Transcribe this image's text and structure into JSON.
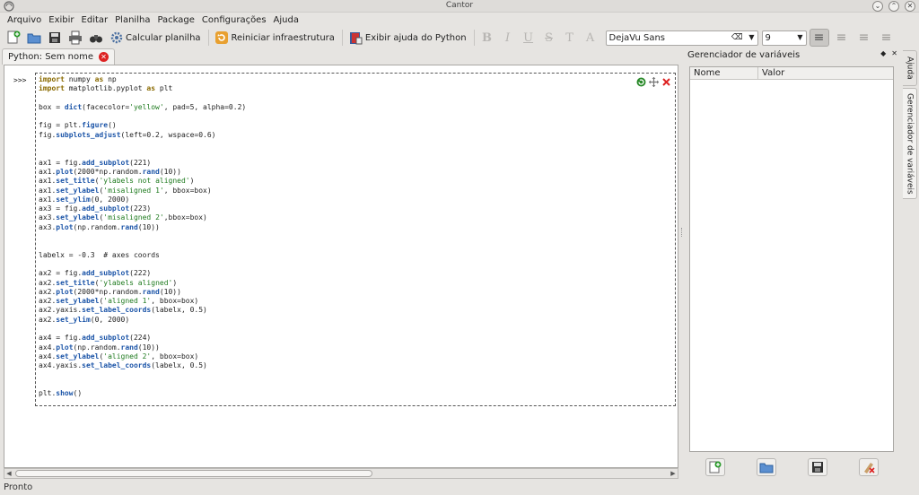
{
  "window": {
    "title": "Cantor"
  },
  "menu": [
    "Arquivo",
    "Exibir",
    "Editar",
    "Planilha",
    "Package",
    "Configurações",
    "Ajuda"
  ],
  "toolbar": {
    "calc_label": "Calcular planilha",
    "restart_label": "Reiniciar infraestrutura",
    "help_label": "Exibir ajuda do Python",
    "font": "DejaVu Sans",
    "size": "9"
  },
  "tab": {
    "label": "Python: Sem nome"
  },
  "worksheet": {
    "prompt": ">>>",
    "code_lines": [
      "import numpy as np",
      "import matplotlib.pyplot as plt",
      "",
      "box = dict(facecolor='yellow', pad=5, alpha=0.2)",
      "",
      "fig = plt.figure()",
      "fig.subplots_adjust(left=0.2, wspace=0.6)",
      "",
      "",
      "ax1 = fig.add_subplot(221)",
      "ax1.plot(2000*np.random.rand(10))",
      "ax1.set_title('ylabels not aligned')",
      "ax1.set_ylabel('misaligned 1', bbox=box)",
      "ax1.set_ylim(0, 2000)",
      "ax3 = fig.add_subplot(223)",
      "ax3.set_ylabel('misaligned 2',bbox=box)",
      "ax3.plot(np.random.rand(10))",
      "",
      "",
      "labelx = -0.3  # axes coords",
      "",
      "ax2 = fig.add_subplot(222)",
      "ax2.set_title('ylabels aligned')",
      "ax2.plot(2000*np.random.rand(10))",
      "ax2.set_ylabel('aligned 1', bbox=box)",
      "ax2.yaxis.set_label_coords(labelx, 0.5)",
      "ax2.set_ylim(0, 2000)",
      "",
      "ax4 = fig.add_subplot(224)",
      "ax4.plot(np.random.rand(10))",
      "ax4.set_ylabel('aligned 2', bbox=box)",
      "ax4.yaxis.set_label_coords(labelx, 0.5)",
      "",
      "",
      "plt.show()"
    ]
  },
  "panel": {
    "title": "Gerenciador de variáveis",
    "col_name": "Nome",
    "col_value": "Valor"
  },
  "side_tabs": {
    "help": "Ajuda",
    "vars": "Gerenciador de variáveis"
  },
  "status": {
    "text": "Pronto"
  },
  "colors": {
    "keyword": "#8a6a00",
    "function": "#1c55a8",
    "string": "#1e7a1e"
  }
}
